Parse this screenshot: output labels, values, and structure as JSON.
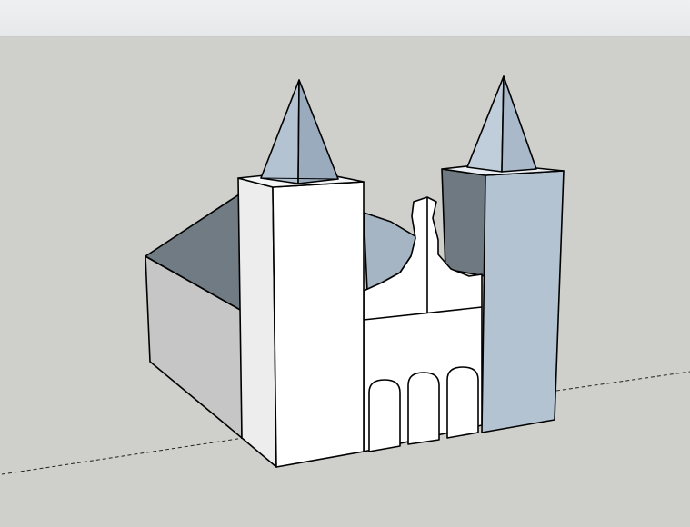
{
  "app": {
    "type": "3d-modeling-viewport"
  },
  "scene": {
    "model": "church",
    "towers": 2,
    "spires": 2,
    "arched_windows": 3,
    "colors": {
      "background": "#cfcfcb",
      "front_face": "#ffffff",
      "side_face_light": "#c8c8c8",
      "roof_dark": "#6e7982",
      "roof_mid": "#7c8790",
      "blue_face": "#b4c3d2",
      "blue_face_dark": "#9aabbd",
      "edge": "#000000",
      "axis_line": "#222222"
    }
  }
}
